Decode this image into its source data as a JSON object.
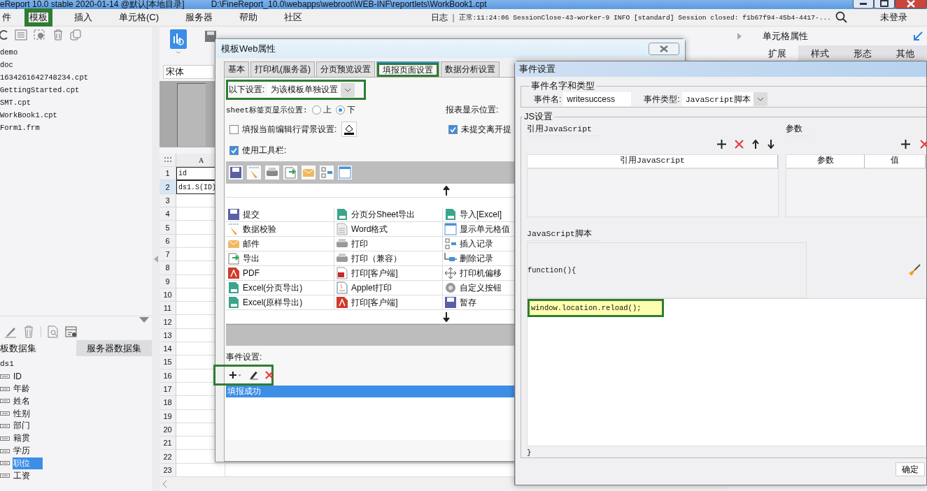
{
  "app": {
    "title": "eReport 10.0 stable 2020-01-14 @默认[本地目录]",
    "path": "D:\\FineReport_10.0\\webapps\\webroot\\WEB-INF\\reportlets\\WorkBook1.cpt"
  },
  "menu": [
    {
      "label": "件",
      "highlighted": false
    },
    {
      "label": "模板",
      "highlighted": true
    },
    {
      "label": "插入",
      "highlighted": false
    },
    {
      "label": "单元格(C)",
      "highlighted": false
    },
    {
      "label": "服务器",
      "highlighted": false
    },
    {
      "label": "帮助",
      "highlighted": false
    },
    {
      "label": "社区",
      "highlighted": false
    }
  ],
  "status": {
    "log": "日志",
    "separator": "|",
    "message": "正常:11:24:06 SessionClose-43-worker-9 INFO [standard] Session closed: f1b67f94-45b4-4417-...",
    "user": "未登录"
  },
  "files": [
    "demo",
    "doc",
    "1634261642748234.cpt",
    "GettingStarted.cpt",
    "SMT.cpt",
    "WorkBook1.cpt",
    "Form1.frm"
  ],
  "dataset_tabs": [
    {
      "label": "板数据集",
      "selected": true
    },
    {
      "label": "服务器数据集",
      "selected": false
    }
  ],
  "dataset": {
    "name": "ds1",
    "fields": [
      {
        "label": "ID",
        "selected": false
      },
      {
        "label": "年龄",
        "selected": false
      },
      {
        "label": "姓名",
        "selected": false
      },
      {
        "label": "性别",
        "selected": false
      },
      {
        "label": "部门",
        "selected": false
      },
      {
        "label": "籍贯",
        "selected": false
      },
      {
        "label": "学历",
        "selected": false
      },
      {
        "label": "职位",
        "selected": true
      },
      {
        "label": "工资",
        "selected": false
      }
    ]
  },
  "font_field": "宋体",
  "sheet": {
    "column": "A",
    "rows": [
      {
        "number": "1",
        "cell": "id",
        "selected": false
      },
      {
        "number": "2",
        "cell": "ds1.S(ID)",
        "selected": true
      },
      {
        "number": "3",
        "selected": false
      },
      {
        "number": "4",
        "selected": false
      },
      {
        "number": "5",
        "selected": false
      },
      {
        "number": "6",
        "selected": false
      },
      {
        "number": "7",
        "selected": false
      },
      {
        "number": "8",
        "selected": false
      },
      {
        "number": "9",
        "selected": false
      },
      {
        "number": "10",
        "selected": false
      },
      {
        "number": "11",
        "selected": false
      },
      {
        "number": "12",
        "selected": false
      },
      {
        "number": "13",
        "selected": false
      },
      {
        "number": "14",
        "selected": false
      },
      {
        "number": "15",
        "selected": false
      },
      {
        "number": "16",
        "selected": false
      },
      {
        "number": "17",
        "selected": false
      },
      {
        "number": "18",
        "selected": false
      },
      {
        "number": "19",
        "selected": false
      },
      {
        "number": "20",
        "selected": false
      },
      {
        "number": "21",
        "selected": false
      },
      {
        "number": "22",
        "selected": false
      },
      {
        "number": "23",
        "selected": false
      }
    ]
  },
  "cell_panel": {
    "title": "单元格属性",
    "tabs": [
      {
        "label": "扩展",
        "selected": true
      },
      {
        "label": "样式",
        "selected": false
      },
      {
        "label": "形态",
        "selected": false
      },
      {
        "label": "其他",
        "selected": false
      }
    ]
  },
  "web_dialog": {
    "title": "模板Web属性",
    "tabs": [
      {
        "label": "基本",
        "selected": false,
        "highlighted": false
      },
      {
        "label": "打印机(服务器)",
        "selected": false,
        "highlighted": false
      },
      {
        "label": "分页预览设置",
        "selected": false,
        "highlighted": false
      },
      {
        "label": "填报页面设置",
        "selected": true,
        "highlighted": true
      },
      {
        "label": "数据分析设置",
        "selected": false,
        "highlighted": false
      }
    ],
    "scope": {
      "label": "以下设置:",
      "value": "为该模板单独设置",
      "highlighted": true
    },
    "sheet_position": {
      "label": "sheet标签页显示位置:",
      "options": [
        {
          "label": "上",
          "selected": false
        },
        {
          "label": "下",
          "selected": true
        }
      ]
    },
    "report_position_label": "报表显示位置:",
    "row_background": {
      "label": "填报当前编辑行背景设置:",
      "checked": false
    },
    "unsaved_prompt": {
      "label": "未提交离开提",
      "checked": true
    },
    "use_toolbar": {
      "label": "使用工具栏:",
      "checked": true
    },
    "buttons": [
      "提交",
      "分页分Sheet导出",
      "导入[Excel]",
      "数据校验",
      "Word格式",
      "显示单元格值",
      "邮件",
      "打印",
      "插入记录",
      "导出",
      "打印（兼容）",
      "删除记录",
      "PDF",
      "打印[客户端]",
      "打印机偏移",
      "Excel(分页导出)",
      "Applet打印",
      "自定义按钮",
      "Excel(原样导出)",
      "打印[客户端]",
      "暂存"
    ],
    "event_label": "事件设置:",
    "event_toolbar_highlighted": true,
    "events": [
      {
        "label": "填报成功",
        "selected": true
      }
    ]
  },
  "event_dialog": {
    "title": "事件设置",
    "name_group": "事件名字和类型",
    "name_label": "事件名:",
    "name_value": "writesuccess",
    "type_label": "事件类型:",
    "type_value": "JavaScript脚本",
    "js_group": "JS设置",
    "ref_group": "引用JavaScript",
    "ref_column": "引用JavaScript",
    "param_group": "参数",
    "param_columns": [
      "参数",
      "值"
    ],
    "script_group": "JavaScript脚本",
    "script_head": "function(){",
    "script_lines": [
      {
        "text": "window.location.reload();",
        "highlighted": true
      }
    ],
    "script_tail": "}",
    "ok": "确定"
  }
}
